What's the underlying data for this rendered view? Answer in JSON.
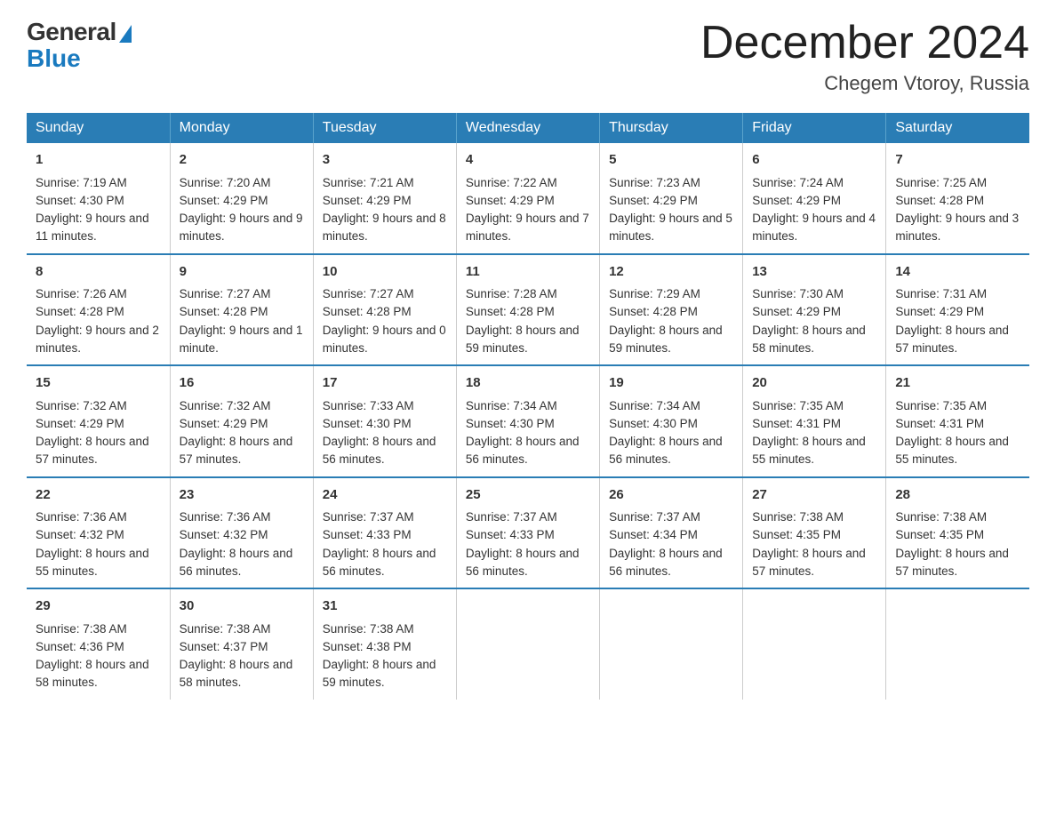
{
  "header": {
    "logo_general": "General",
    "logo_blue": "Blue",
    "month_title": "December 2024",
    "location": "Chegem Vtoroy, Russia"
  },
  "days_of_week": [
    "Sunday",
    "Monday",
    "Tuesday",
    "Wednesday",
    "Thursday",
    "Friday",
    "Saturday"
  ],
  "weeks": [
    [
      {
        "day": "1",
        "sunrise": "7:19 AM",
        "sunset": "4:30 PM",
        "daylight": "9 hours and 11 minutes."
      },
      {
        "day": "2",
        "sunrise": "7:20 AM",
        "sunset": "4:29 PM",
        "daylight": "9 hours and 9 minutes."
      },
      {
        "day": "3",
        "sunrise": "7:21 AM",
        "sunset": "4:29 PM",
        "daylight": "9 hours and 8 minutes."
      },
      {
        "day": "4",
        "sunrise": "7:22 AM",
        "sunset": "4:29 PM",
        "daylight": "9 hours and 7 minutes."
      },
      {
        "day": "5",
        "sunrise": "7:23 AM",
        "sunset": "4:29 PM",
        "daylight": "9 hours and 5 minutes."
      },
      {
        "day": "6",
        "sunrise": "7:24 AM",
        "sunset": "4:29 PM",
        "daylight": "9 hours and 4 minutes."
      },
      {
        "day": "7",
        "sunrise": "7:25 AM",
        "sunset": "4:28 PM",
        "daylight": "9 hours and 3 minutes."
      }
    ],
    [
      {
        "day": "8",
        "sunrise": "7:26 AM",
        "sunset": "4:28 PM",
        "daylight": "9 hours and 2 minutes."
      },
      {
        "day": "9",
        "sunrise": "7:27 AM",
        "sunset": "4:28 PM",
        "daylight": "9 hours and 1 minute."
      },
      {
        "day": "10",
        "sunrise": "7:27 AM",
        "sunset": "4:28 PM",
        "daylight": "9 hours and 0 minutes."
      },
      {
        "day": "11",
        "sunrise": "7:28 AM",
        "sunset": "4:28 PM",
        "daylight": "8 hours and 59 minutes."
      },
      {
        "day": "12",
        "sunrise": "7:29 AM",
        "sunset": "4:28 PM",
        "daylight": "8 hours and 59 minutes."
      },
      {
        "day": "13",
        "sunrise": "7:30 AM",
        "sunset": "4:29 PM",
        "daylight": "8 hours and 58 minutes."
      },
      {
        "day": "14",
        "sunrise": "7:31 AM",
        "sunset": "4:29 PM",
        "daylight": "8 hours and 57 minutes."
      }
    ],
    [
      {
        "day": "15",
        "sunrise": "7:32 AM",
        "sunset": "4:29 PM",
        "daylight": "8 hours and 57 minutes."
      },
      {
        "day": "16",
        "sunrise": "7:32 AM",
        "sunset": "4:29 PM",
        "daylight": "8 hours and 57 minutes."
      },
      {
        "day": "17",
        "sunrise": "7:33 AM",
        "sunset": "4:30 PM",
        "daylight": "8 hours and 56 minutes."
      },
      {
        "day": "18",
        "sunrise": "7:34 AM",
        "sunset": "4:30 PM",
        "daylight": "8 hours and 56 minutes."
      },
      {
        "day": "19",
        "sunrise": "7:34 AM",
        "sunset": "4:30 PM",
        "daylight": "8 hours and 56 minutes."
      },
      {
        "day": "20",
        "sunrise": "7:35 AM",
        "sunset": "4:31 PM",
        "daylight": "8 hours and 55 minutes."
      },
      {
        "day": "21",
        "sunrise": "7:35 AM",
        "sunset": "4:31 PM",
        "daylight": "8 hours and 55 minutes."
      }
    ],
    [
      {
        "day": "22",
        "sunrise": "7:36 AM",
        "sunset": "4:32 PM",
        "daylight": "8 hours and 55 minutes."
      },
      {
        "day": "23",
        "sunrise": "7:36 AM",
        "sunset": "4:32 PM",
        "daylight": "8 hours and 56 minutes."
      },
      {
        "day": "24",
        "sunrise": "7:37 AM",
        "sunset": "4:33 PM",
        "daylight": "8 hours and 56 minutes."
      },
      {
        "day": "25",
        "sunrise": "7:37 AM",
        "sunset": "4:33 PM",
        "daylight": "8 hours and 56 minutes."
      },
      {
        "day": "26",
        "sunrise": "7:37 AM",
        "sunset": "4:34 PM",
        "daylight": "8 hours and 56 minutes."
      },
      {
        "day": "27",
        "sunrise": "7:38 AM",
        "sunset": "4:35 PM",
        "daylight": "8 hours and 57 minutes."
      },
      {
        "day": "28",
        "sunrise": "7:38 AM",
        "sunset": "4:35 PM",
        "daylight": "8 hours and 57 minutes."
      }
    ],
    [
      {
        "day": "29",
        "sunrise": "7:38 AM",
        "sunset": "4:36 PM",
        "daylight": "8 hours and 58 minutes."
      },
      {
        "day": "30",
        "sunrise": "7:38 AM",
        "sunset": "4:37 PM",
        "daylight": "8 hours and 58 minutes."
      },
      {
        "day": "31",
        "sunrise": "7:38 AM",
        "sunset": "4:38 PM",
        "daylight": "8 hours and 59 minutes."
      },
      null,
      null,
      null,
      null
    ]
  ]
}
